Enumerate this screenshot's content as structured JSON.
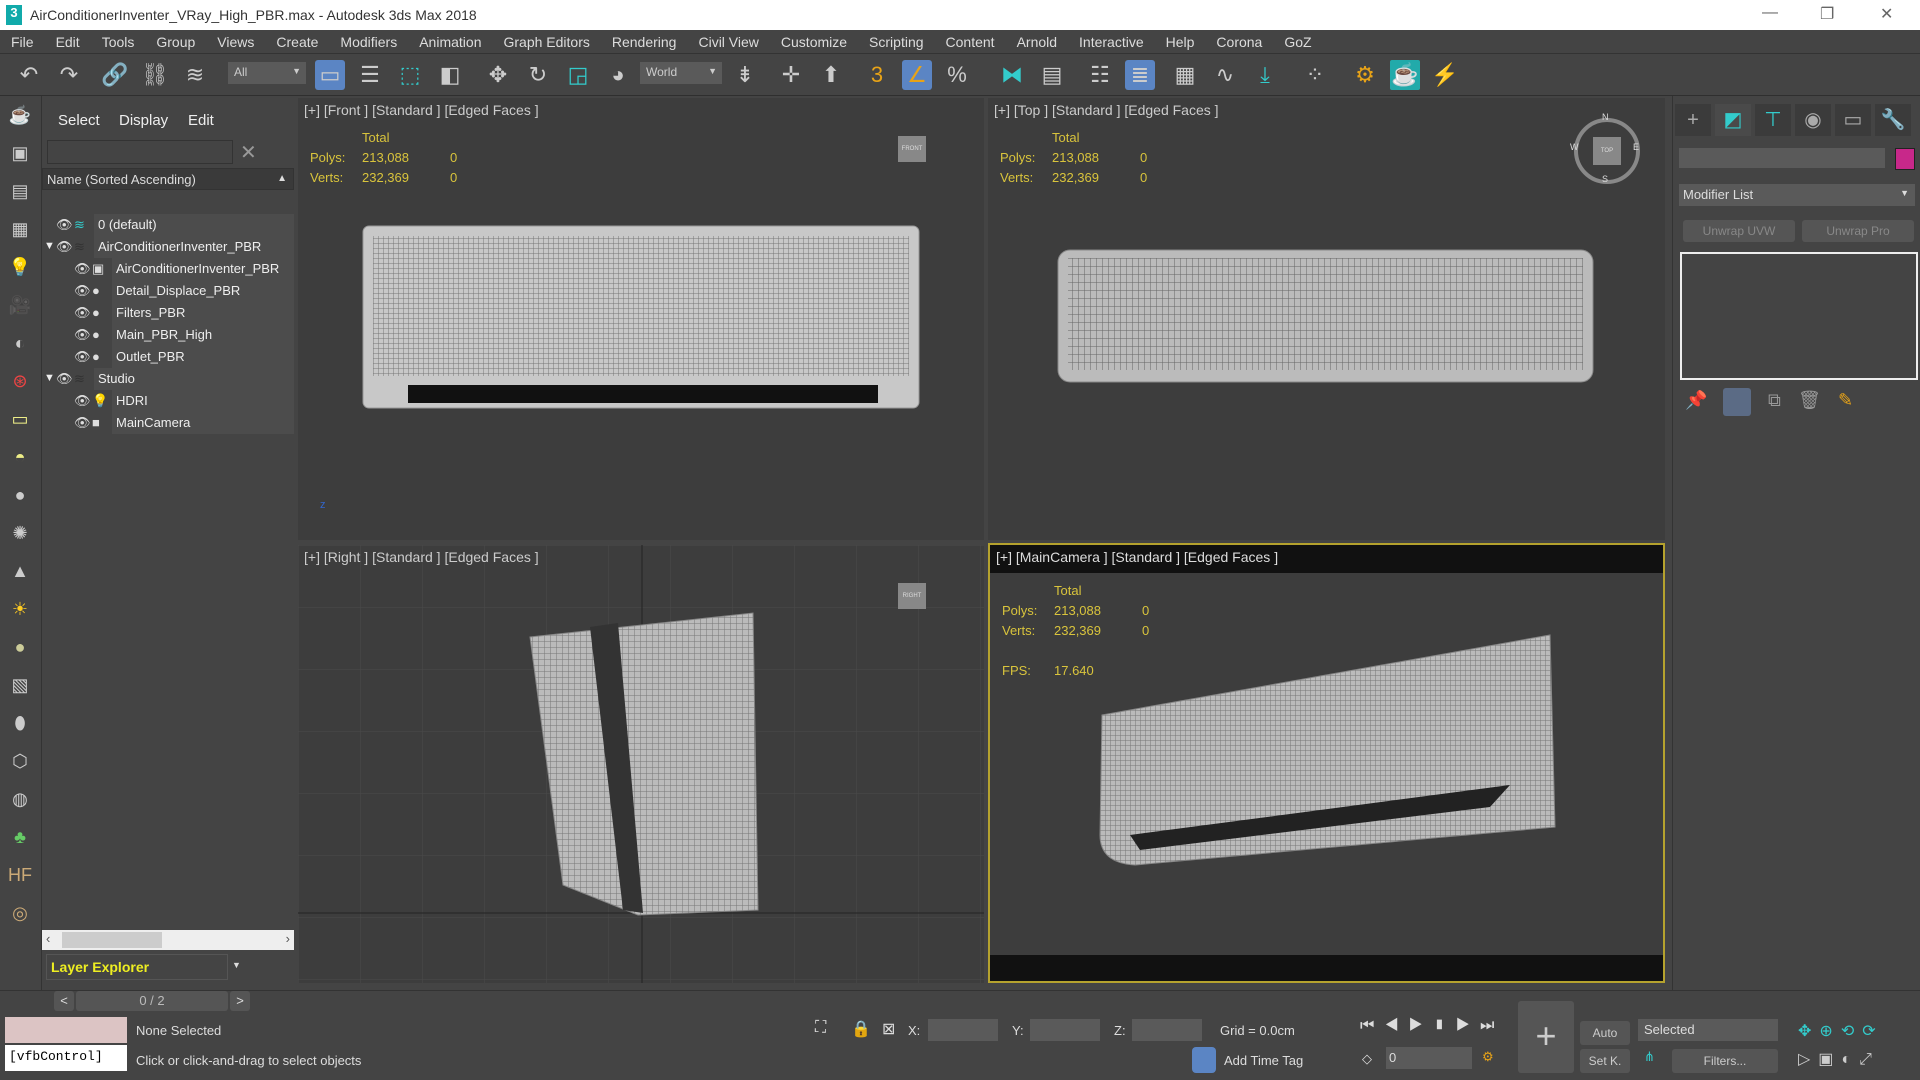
{
  "window": {
    "title": "AirConditionerInventer_VRay_High_PBR.max - Autodesk 3ds Max 2018",
    "app_icon": "3",
    "minimize": "—",
    "restore": "❐",
    "close": "✕"
  },
  "menu": [
    "File",
    "Edit",
    "Tools",
    "Group",
    "Views",
    "Create",
    "Modifiers",
    "Animation",
    "Graph Editors",
    "Rendering",
    "Civil View",
    "Customize",
    "Scripting",
    "Content",
    "Arnold",
    "Interactive",
    "Help",
    "Corona",
    "GoZ"
  ],
  "toolbar": {
    "selection_filter": "All",
    "reference_coord": "World"
  },
  "explorer": {
    "tabs": [
      "Select",
      "Display",
      "Edit"
    ],
    "search_value": "",
    "clear": "✕",
    "column_header": "Name (Sorted Ascending)",
    "sort_arrow": "▲",
    "items": [
      {
        "label": "0 (default)",
        "level": 0
      },
      {
        "label": "AirConditionerInventer_PBR",
        "level": 0,
        "expanded": true
      },
      {
        "label": "AirConditionerInventer_PBR",
        "level": 1
      },
      {
        "label": "Detail_Displace_PBR",
        "level": 1
      },
      {
        "label": "Filters_PBR",
        "level": 1
      },
      {
        "label": "Main_PBR_High",
        "level": 1
      },
      {
        "label": "Outlet_PBR",
        "level": 1
      },
      {
        "label": "Studio",
        "level": 0,
        "expanded": true
      },
      {
        "label": "HDRI",
        "level": 1
      },
      {
        "label": "MainCamera",
        "level": 1
      }
    ],
    "explorer_type": "Layer Explorer",
    "page": "0 / 2",
    "prev": "<",
    "next": ">"
  },
  "viewports": [
    {
      "label": "[+] [Front ] [Standard ] [Edged Faces ]",
      "total": "Total",
      "polys_label": "Polys:",
      "polys": "213,088",
      "polys_sel": "0",
      "verts_label": "Verts:",
      "verts": "232,369",
      "verts_sel": "0",
      "cube": "FRONT"
    },
    {
      "label": "[+] [Top ] [Standard ] [Edged Faces ]",
      "total": "Total",
      "polys_label": "Polys:",
      "polys": "213,088",
      "polys_sel": "0",
      "verts_label": "Verts:",
      "verts": "232,369",
      "verts_sel": "0",
      "cube": "TOP",
      "compass": [
        "N",
        "S",
        "E",
        "W"
      ]
    },
    {
      "label": "[+] [Right ] [Standard ] [Edged Faces ]",
      "cube": "RIGHT"
    },
    {
      "label": "[+] [MainCamera ] [Standard ] [Edged Faces ]",
      "total": "Total",
      "polys_label": "Polys:",
      "polys": "213,088",
      "polys_sel": "0",
      "verts_label": "Verts:",
      "verts": "232,369",
      "verts_sel": "0",
      "fps_label": "FPS:",
      "fps": "17.640"
    }
  ],
  "command_panel": {
    "object_color": "#c8288a",
    "modifier_list": "Modifier List",
    "buttons": [
      "Unwrap UVW",
      "Unwrap Pro"
    ]
  },
  "status": {
    "selection": "None Selected",
    "listener": "[vfbControl]",
    "prompt": "Click or click-and-drag to select objects",
    "x_label": "X:",
    "y_label": "Y:",
    "z_label": "Z:",
    "grid": "Grid = 0.0cm",
    "add_time_tag": "Add Time Tag",
    "frame": "0",
    "auto": "Auto",
    "key_filter": "Selected",
    "set_key": "Set K.",
    "filters": "Filters..."
  },
  "colors": {
    "accent": "#5b85c4",
    "stats": "#d9c43c",
    "active_viewport": "#b5a22e"
  }
}
